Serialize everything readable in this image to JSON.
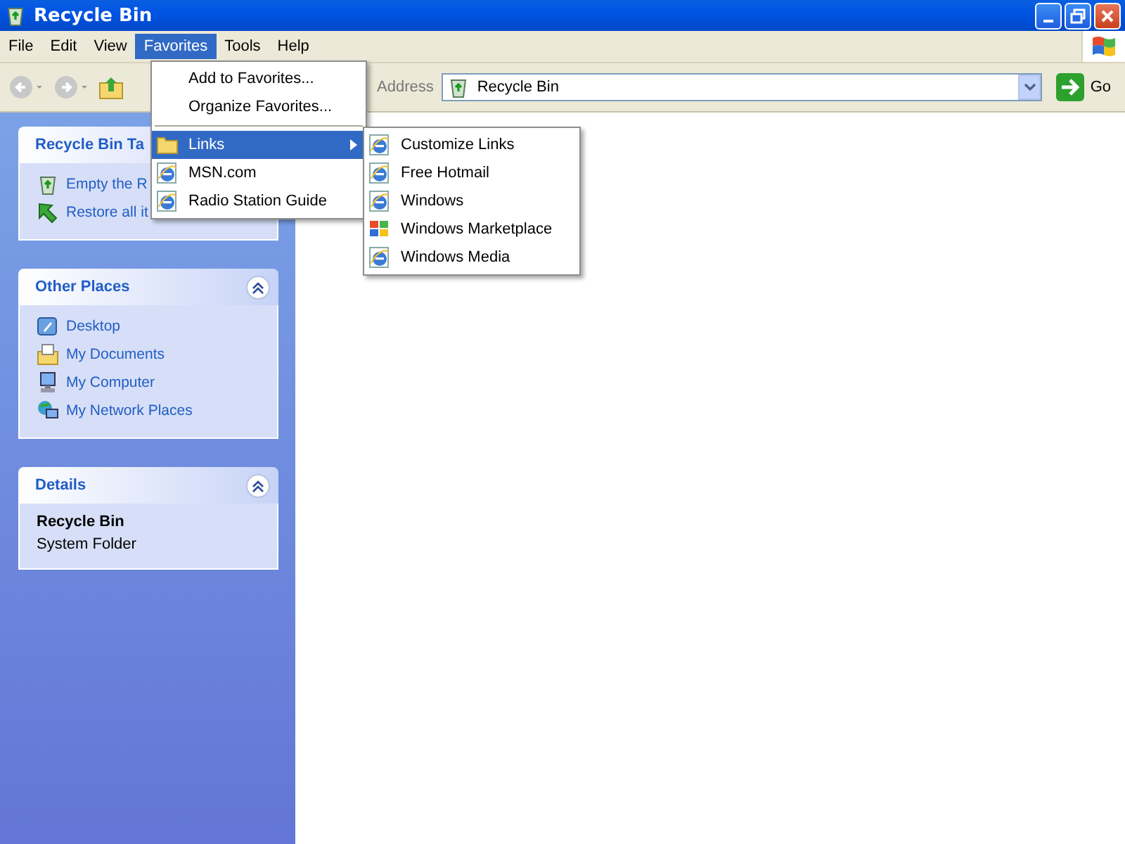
{
  "window": {
    "title": "Recycle Bin"
  },
  "menu_bar": [
    {
      "label": "File",
      "selected": false
    },
    {
      "label": "Edit",
      "selected": false
    },
    {
      "label": "View",
      "selected": false
    },
    {
      "label": "Favorites",
      "selected": true
    },
    {
      "label": "Tools",
      "selected": false
    },
    {
      "label": "Help",
      "selected": false
    }
  ],
  "address_bar": {
    "label": "Address",
    "value": "Recycle Bin",
    "go_button": "Go"
  },
  "task_panes": [
    {
      "title": "Recycle Bin Ta",
      "kind": "tasks",
      "items": [
        {
          "label": "Empty the R",
          "kind": "bin"
        },
        {
          "label": "Restore all it",
          "kind": "restore"
        }
      ]
    },
    {
      "title": "Other Places",
      "kind": "places",
      "items": [
        {
          "label": "Desktop",
          "kind": "desktop"
        },
        {
          "label": "My Documents",
          "kind": "documents"
        },
        {
          "label": "My Computer",
          "kind": "computer"
        },
        {
          "label": "My Network Places",
          "kind": "network"
        }
      ]
    },
    {
      "title": "Details",
      "kind": "details",
      "name": "Recycle Bin",
      "description": "System Folder"
    }
  ],
  "favorites_menu": [
    {
      "kind": "command",
      "label": "Add to Favorites...",
      "selected": false
    },
    {
      "kind": "command",
      "label": "Organize Favorites...",
      "selected": false
    },
    {
      "kind": "separator"
    },
    {
      "kind": "folder",
      "label": "Links",
      "selected": true
    },
    {
      "kind": "link",
      "label": "MSN.com",
      "selected": false
    },
    {
      "kind": "link",
      "label": "Radio Station Guide",
      "selected": false
    }
  ],
  "links_submenu": [
    {
      "kind": "link",
      "label": "Customize Links",
      "selected": false
    },
    {
      "kind": "link",
      "label": "Free Hotmail",
      "selected": false
    },
    {
      "kind": "link",
      "label": "Windows",
      "selected": false
    },
    {
      "kind": "marketplace",
      "label": "Windows Marketplace",
      "selected": false
    },
    {
      "kind": "link",
      "label": "Windows Media",
      "selected": false
    }
  ]
}
